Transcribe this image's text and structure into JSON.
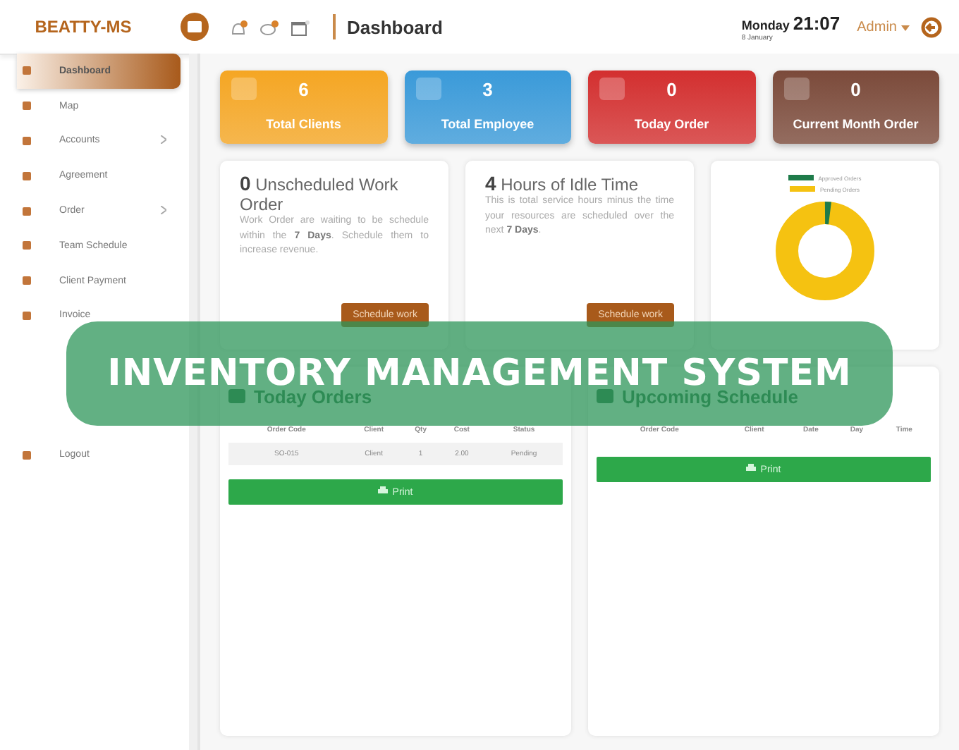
{
  "topbar": {
    "logo": "BEATTY-MS",
    "page_title": "Dashboard",
    "day": "Monday",
    "time": "21:07",
    "date": "8 January",
    "user": "Admin"
  },
  "sidebar": {
    "items": [
      {
        "label": "Dashboard",
        "selected": true,
        "submenu": false
      },
      {
        "label": "Map",
        "selected": false,
        "submenu": false
      },
      {
        "label": "Accounts",
        "selected": false,
        "submenu": true
      },
      {
        "label": "Agreement",
        "selected": false,
        "submenu": false
      },
      {
        "label": "Order",
        "selected": false,
        "submenu": true
      },
      {
        "label": "Team Schedule",
        "selected": false,
        "submenu": false
      },
      {
        "label": "Client Payment",
        "selected": false,
        "submenu": false
      },
      {
        "label": "Invoice",
        "selected": false,
        "submenu": false
      },
      {
        "label": "Logout",
        "selected": false,
        "submenu": false
      }
    ]
  },
  "stats": [
    {
      "value": "6",
      "label": "Total Clients",
      "color": "#f5a623"
    },
    {
      "value": "3",
      "label": "Total Employee",
      "color": "#3a9ad9"
    },
    {
      "value": "0",
      "label": "Today Order",
      "color": "#d32f2f"
    },
    {
      "value": "0",
      "label": "Current Month Order",
      "color": "#7b4a3a"
    }
  ],
  "info_cards": [
    {
      "number": "0",
      "title": "Unscheduled Work Order",
      "text": "Work Order are waiting to be schedule within the **7 Days**. Schedule them to increase revenue.",
      "button": "Schedule work"
    },
    {
      "number": "4",
      "title": "Hours of Idle Time",
      "text": "This is total service hours minus the time your resources are scheduled over the next **7 Days**.",
      "button": "Schedule work"
    }
  ],
  "orders_chart": {
    "legend": [
      {
        "label": "Approved Orders",
        "color": "#1e7b4a"
      },
      {
        "label": "Pending Orders",
        "color": "#f5c211"
      }
    ]
  },
  "tables": [
    {
      "title": "Today Orders",
      "columns": [
        "Order Code",
        "Client",
        "Qty",
        "Cost",
        "Status"
      ],
      "rows": [
        [
          "SO-015",
          "Client",
          "1",
          "2.00",
          "Pending"
        ]
      ],
      "print": "Print"
    },
    {
      "title": "Upcoming Schedule",
      "columns": [
        "Order Code",
        "Client",
        "Date",
        "Day",
        "Time"
      ],
      "print": "Print"
    }
  ],
  "banner": {
    "text": "INVENTORY MANAGEMENT SYSTEM"
  }
}
